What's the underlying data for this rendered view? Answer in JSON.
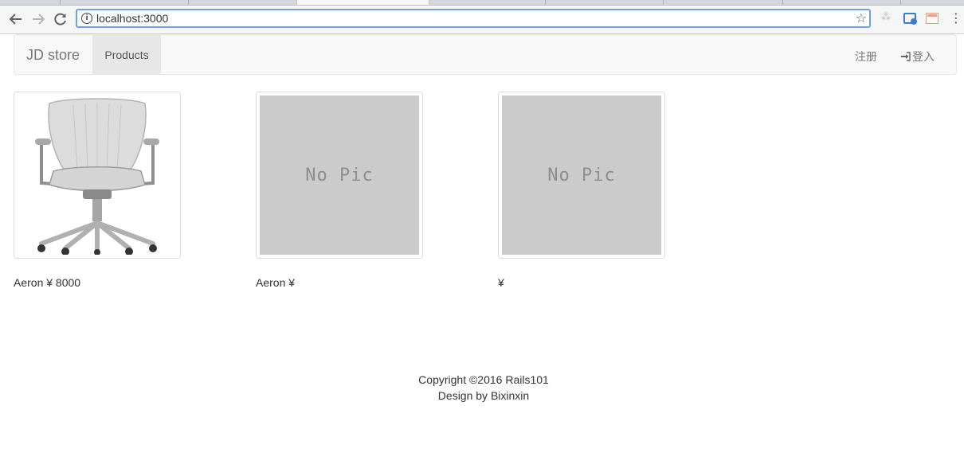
{
  "browser": {
    "address": "localhost:3000",
    "icons": {
      "back": "arrow-left-icon",
      "forward": "arrow-right-icon",
      "reload": "reload-icon",
      "info": "info-icon",
      "bookmark": "star-icon",
      "menu": "more-vert-icon"
    }
  },
  "navbar": {
    "brand": "JD store",
    "products": "Products",
    "register": "注册",
    "login": "登入"
  },
  "products": [
    {
      "caption": "Aeron ¥ 8000",
      "image": "chair-image"
    },
    {
      "caption": "Aeron ¥",
      "image": "no-pic",
      "placeholder": "No Pic"
    },
    {
      "caption": "¥",
      "image": "no-pic",
      "placeholder": "No Pic"
    }
  ],
  "footer": {
    "copyright": "Copyright ©2016 Rails101",
    "design": "Design by Bixinxin"
  },
  "colors": {
    "navbar_bg": "#f8f8f8",
    "active_nav_bg": "#e7e7e7",
    "placeholder_bg": "#cbcbcb",
    "omnibox_focus": "#6ea3e0"
  }
}
